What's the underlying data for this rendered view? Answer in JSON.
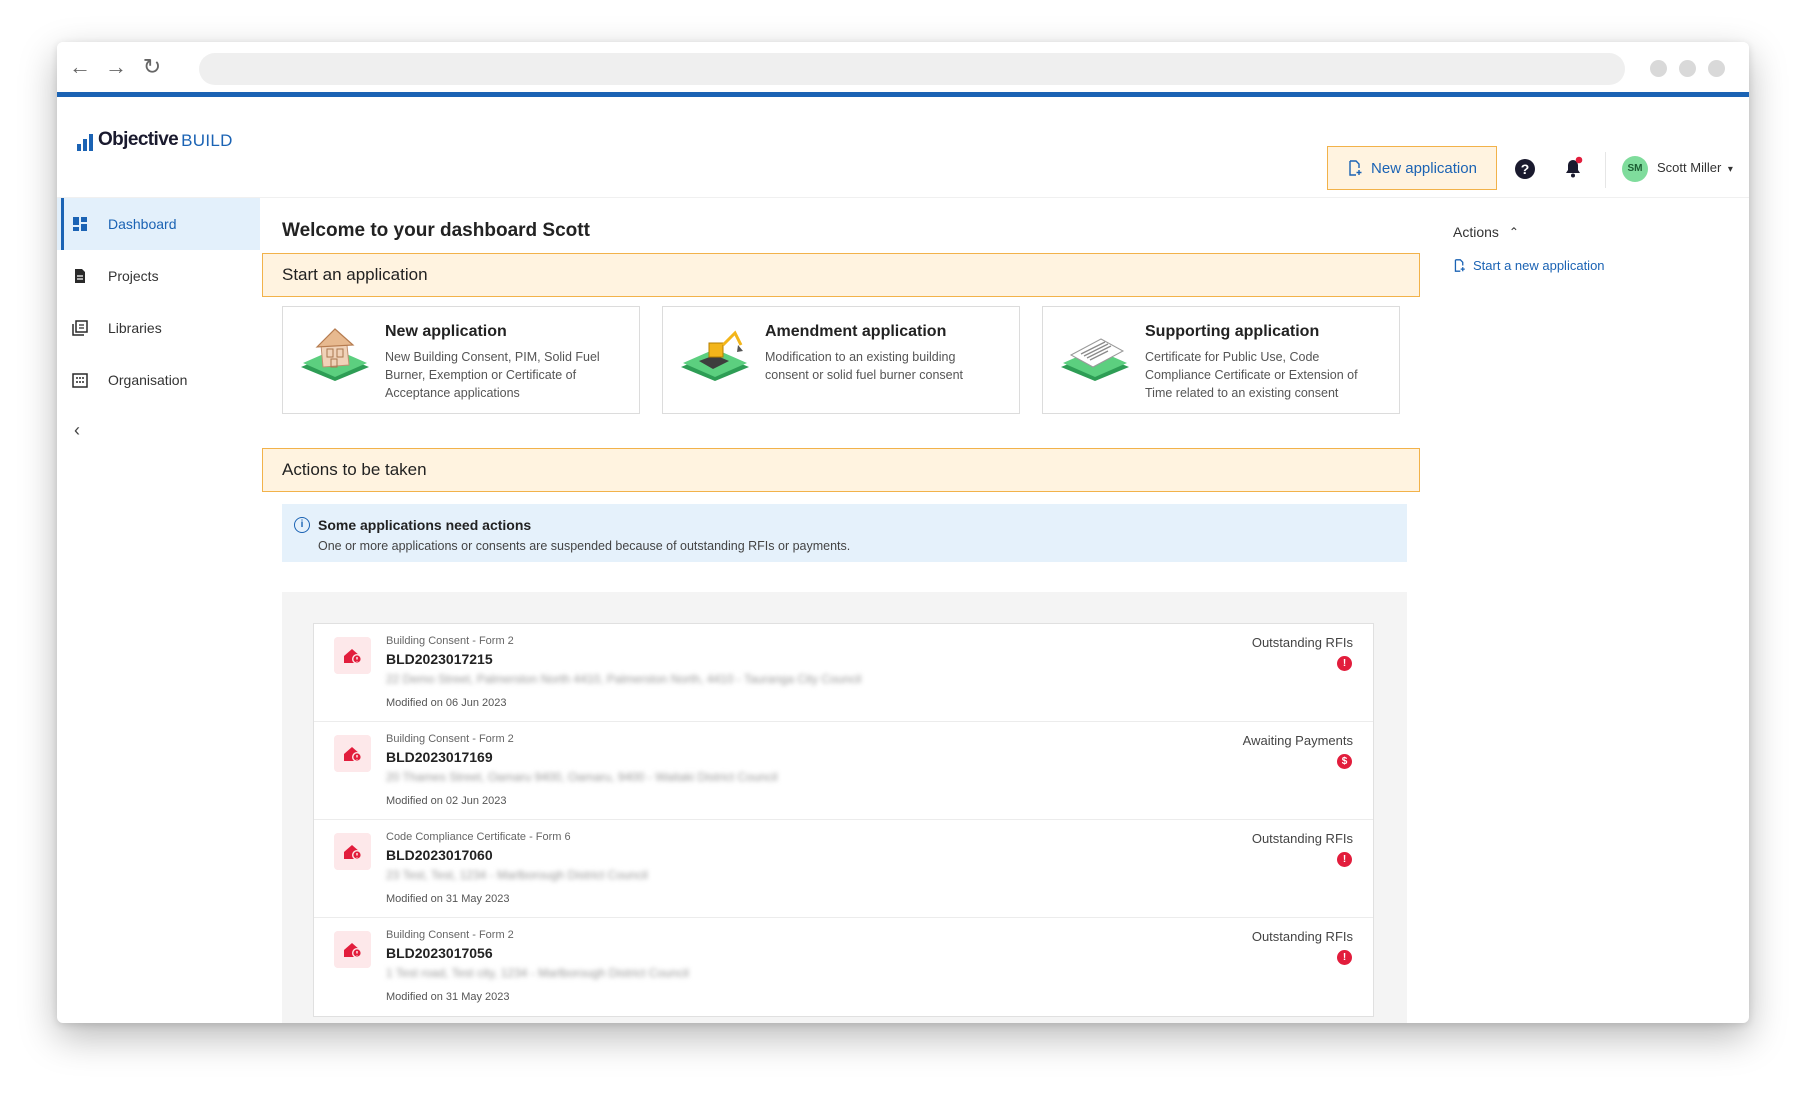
{
  "app": {
    "logo_word": "Objective",
    "logo_build": "BUILD"
  },
  "header": {
    "new_application_label": "New application",
    "help_glyph": "?",
    "user_initials": "SM",
    "user_name": "Scott Miller",
    "user_caret": "▾",
    "notification_dot": true
  },
  "browser": {
    "back_glyph": "←",
    "forward_glyph": "→",
    "reload_glyph": "↻"
  },
  "sidebar": {
    "items": [
      {
        "label": "Dashboard",
        "icon": "dashboard-icon",
        "active": true
      },
      {
        "label": "Projects",
        "icon": "document-icon",
        "active": false
      },
      {
        "label": "Libraries",
        "icon": "library-icon",
        "active": false
      },
      {
        "label": "Organisation",
        "icon": "building-icon",
        "active": false
      }
    ],
    "collapse_glyph": "‹"
  },
  "main": {
    "welcome": "Welcome to your dashboard Scott",
    "start_section": "Start an application",
    "cards": [
      {
        "title": "New application",
        "desc": "New Building Consent, PIM, Solid Fuel Burner, Exemption or Certificate of Acceptance applications",
        "icon": "house-illustration"
      },
      {
        "title": "Amendment application",
        "desc": "Modification to an existing building consent or solid fuel burner consent",
        "icon": "excavator-illustration"
      },
      {
        "title": "Supporting application",
        "desc": "Certificate for Public Use, Code Compliance Certificate or Extension of Time related to an existing consent",
        "icon": "certificate-illustration"
      }
    ],
    "actions_section": "Actions to be taken",
    "info": {
      "icon_glyph": "i",
      "title": "Some applications need actions",
      "text": "One or more applications or consents are suspended because of outstanding RFIs or payments."
    },
    "applications": [
      {
        "type": "Building Consent - Form 2",
        "id": "BLD2023017215",
        "address": "22 Demo Street, Palmerston North 4410, Palmerston North, 4410 - Tauranga City Council",
        "modified": "Modified on 06 Jun 2023",
        "status": "Outstanding RFIs",
        "badge": "!"
      },
      {
        "type": "Building Consent - Form 2",
        "id": "BLD2023017169",
        "address": "20 Thames Street, Oamaru 9400, Oamaru, 9400 - Waitaki District Council",
        "modified": "Modified on 02 Jun 2023",
        "status": "Awaiting Payments",
        "badge": "$"
      },
      {
        "type": "Code Compliance Certificate - Form 6",
        "id": "BLD2023017060",
        "address": "23 Test, Test, 1234 - Marlborough District Council",
        "modified": "Modified on 31 May 2023",
        "status": "Outstanding RFIs",
        "badge": "!"
      },
      {
        "type": "Building Consent - Form 2",
        "id": "BLD2023017056",
        "address": "1 Test road, Test city, 1234 - Marlborough District Council",
        "modified": "Modified on 31 May 2023",
        "status": "Outstanding RFIs",
        "badge": "!"
      }
    ]
  },
  "actions_panel": {
    "title": "Actions",
    "caret": "⌃",
    "link": "Start a new application"
  },
  "colors": {
    "brand_blue": "#1b63b4",
    "highlight_bg": "#fff3e0",
    "highlight_border": "#f2b24a",
    "alert_red": "#e21d3c",
    "info_bg": "#e5f1fb"
  }
}
